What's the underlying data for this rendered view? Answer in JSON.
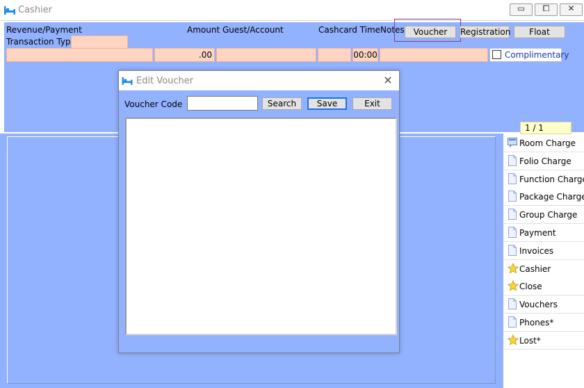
{
  "window": {
    "title": "Cashier",
    "minimize_glyph": "▭",
    "maximize_glyph": "⧠",
    "close_glyph": "✕"
  },
  "header": {
    "revenue_payment": "Revenue/Payment",
    "amount_guest_account": "Amount Guest/Account",
    "cashcard_time": "Cashcard Time",
    "notes": "Notes",
    "transaction_type": "Transaction Type"
  },
  "buttons": {
    "voucher": "Voucher",
    "registration": "Registration",
    "float": "Float"
  },
  "fields": {
    "amount": ".00",
    "time": "00:00",
    "transaction_type": ""
  },
  "complimentary": {
    "label": "Complimentary",
    "checked": false
  },
  "page_indicator": "1 / 1",
  "sidebar": {
    "items": [
      {
        "label": "Room Charge",
        "icon": "room-charge-icon"
      },
      {
        "label": "Folio Charge",
        "icon": "document-icon"
      },
      {
        "label": "Function Charge",
        "icon": "document-icon"
      },
      {
        "label": "Package Charge",
        "icon": "document-icon"
      },
      {
        "label": "Group Charge",
        "icon": "document-icon"
      },
      {
        "label": "Payment",
        "icon": "document-icon"
      },
      {
        "label": "Invoices",
        "icon": "document-icon"
      },
      {
        "label": "Cashier",
        "icon": "star-icon"
      },
      {
        "label": "Close",
        "icon": "star-icon"
      },
      {
        "label": "Vouchers",
        "icon": "document-icon"
      },
      {
        "label": "Phones*",
        "icon": "document-icon"
      },
      {
        "label": "Lost*",
        "icon": "star-icon"
      }
    ]
  },
  "dialog": {
    "title": "Edit Voucher",
    "voucher_code_label": "Voucher Code",
    "voucher_code_value": "",
    "search_button": "Search",
    "save_button": "Save",
    "exit_button": "Exit",
    "close_glyph": "✕"
  },
  "colors": {
    "panel": "#92b1fe",
    "field": "#ffd5c2",
    "accent": "#1e88e5",
    "indicator": "#ffffcc"
  }
}
